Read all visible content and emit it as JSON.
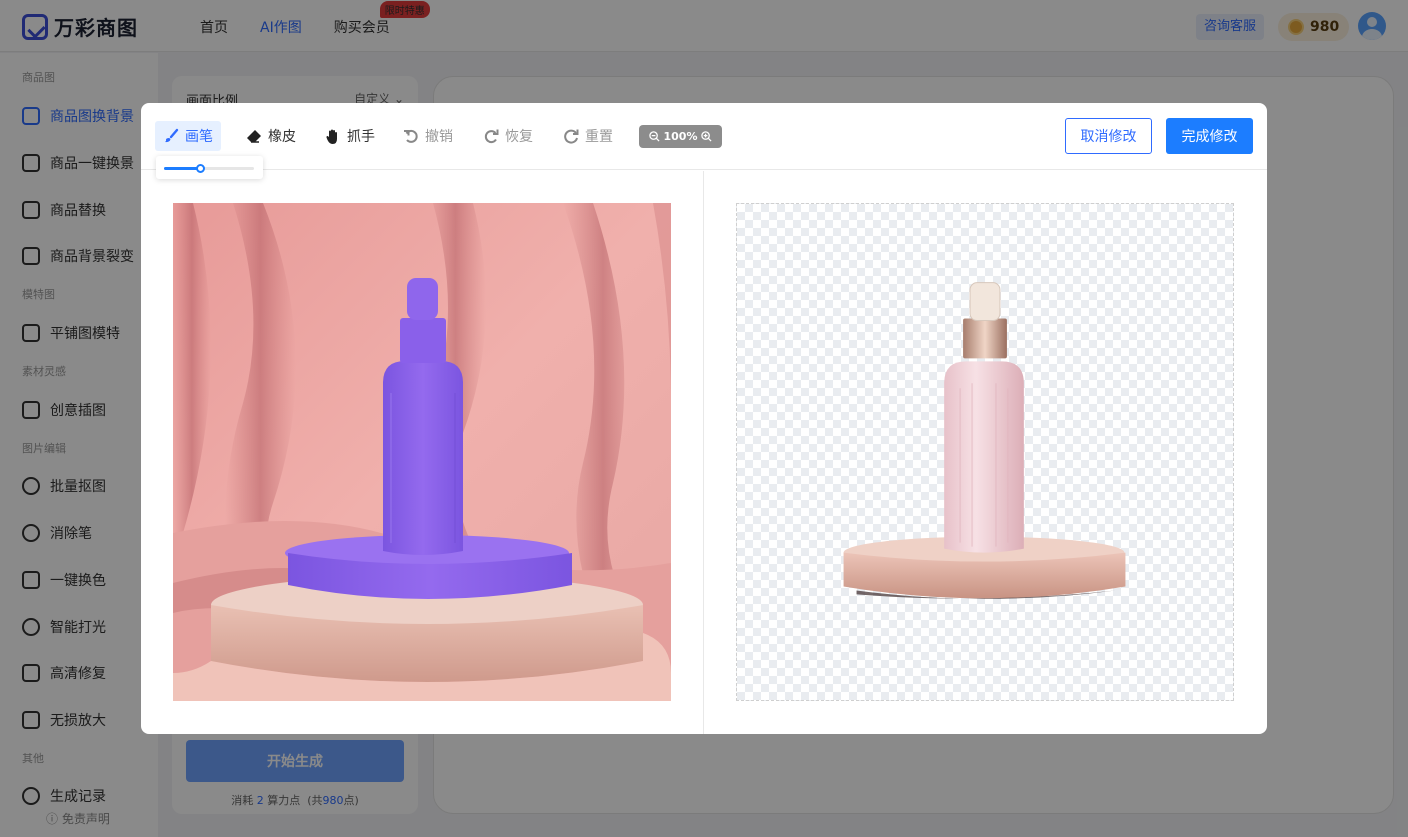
{
  "app": {
    "brand": "万彩商图"
  },
  "topnav": {
    "home": "首页",
    "ai_draw": "AI作图",
    "vip": "购买会员",
    "vip_badge": "限时特惠"
  },
  "header": {
    "consult": "咨询客服",
    "points": "980"
  },
  "sidebar": {
    "groups": {
      "product": "商品图",
      "model": "模特图",
      "material": "素材灵感",
      "edit": "图片编辑",
      "other": "其他"
    },
    "items": [
      {
        "label": "商品图换背景"
      },
      {
        "label": "商品一键换景"
      },
      {
        "label": "商品替换"
      },
      {
        "label": "商品背景裂变"
      },
      {
        "label": "平铺图模特"
      },
      {
        "label": "创意插图"
      },
      {
        "label": "批量抠图"
      },
      {
        "label": "消除笔"
      },
      {
        "label": "一键换色"
      },
      {
        "label": "智能打光"
      },
      {
        "label": "高清修复"
      },
      {
        "label": "无损放大"
      },
      {
        "label": "生成记录"
      }
    ],
    "disclaimer": "ⓘ 免责声明"
  },
  "panel": {
    "ratio_label": "画面比例",
    "ratio_value": "自定义",
    "generate": "开始生成",
    "cost_prefix": "消耗",
    "cost_value": "2",
    "cost_unit": "算力点",
    "cost_total_prefix": "(共",
    "cost_total": "980",
    "cost_total_suffix": "点)"
  },
  "modal": {
    "tools": {
      "brush": "画笔",
      "eraser": "橡皮",
      "hand": "抓手",
      "undo": "撤销",
      "redo": "恢复",
      "reset": "重置"
    },
    "zoom": "100%",
    "brush_size_fraction": 0.4,
    "cancel": "取消修改",
    "done": "完成修改"
  },
  "colors": {
    "accent": "#1c7dff",
    "mask": "#8f62ea",
    "vip_badge": "#e23b3b"
  }
}
